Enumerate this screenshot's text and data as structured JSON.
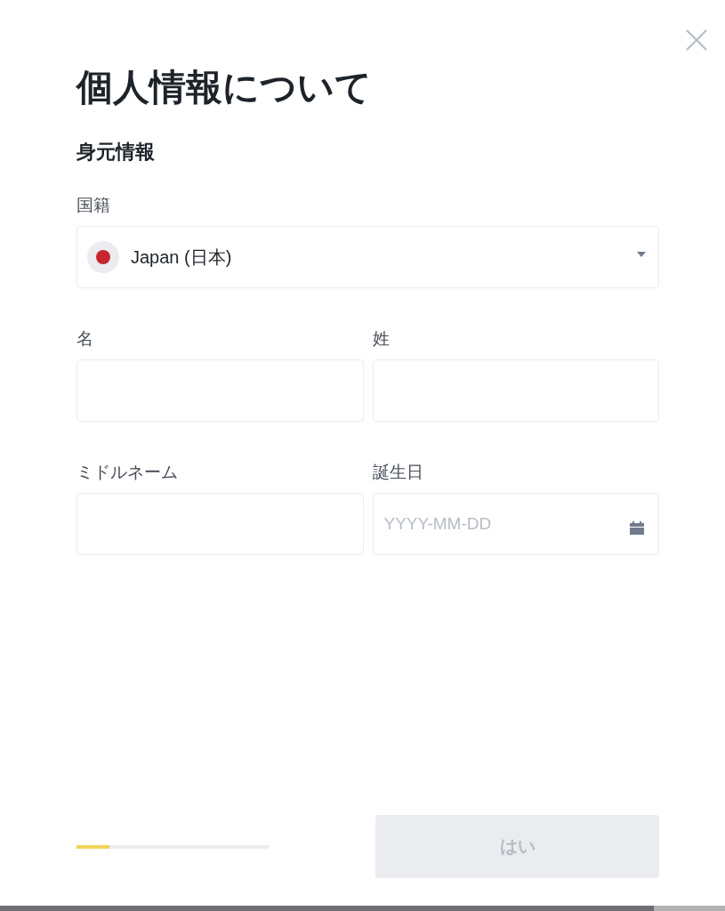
{
  "dialog": {
    "title": "個人情報について",
    "section_heading": "身元情報"
  },
  "fields": [
    {
      "kind": "select",
      "label": "国籍",
      "value": "Japan (日本)"
    },
    {
      "kind": "text",
      "label": "名"
    },
    {
      "kind": "text",
      "label": "姓"
    },
    {
      "kind": "text",
      "label": "ミドルネーム"
    },
    {
      "kind": "date",
      "label": "誕生日",
      "placeholder": "YYYY-MM-DD"
    }
  ],
  "progress": {
    "level": 0.17
  },
  "submit_button": {
    "label": "はい",
    "disabled": true
  }
}
